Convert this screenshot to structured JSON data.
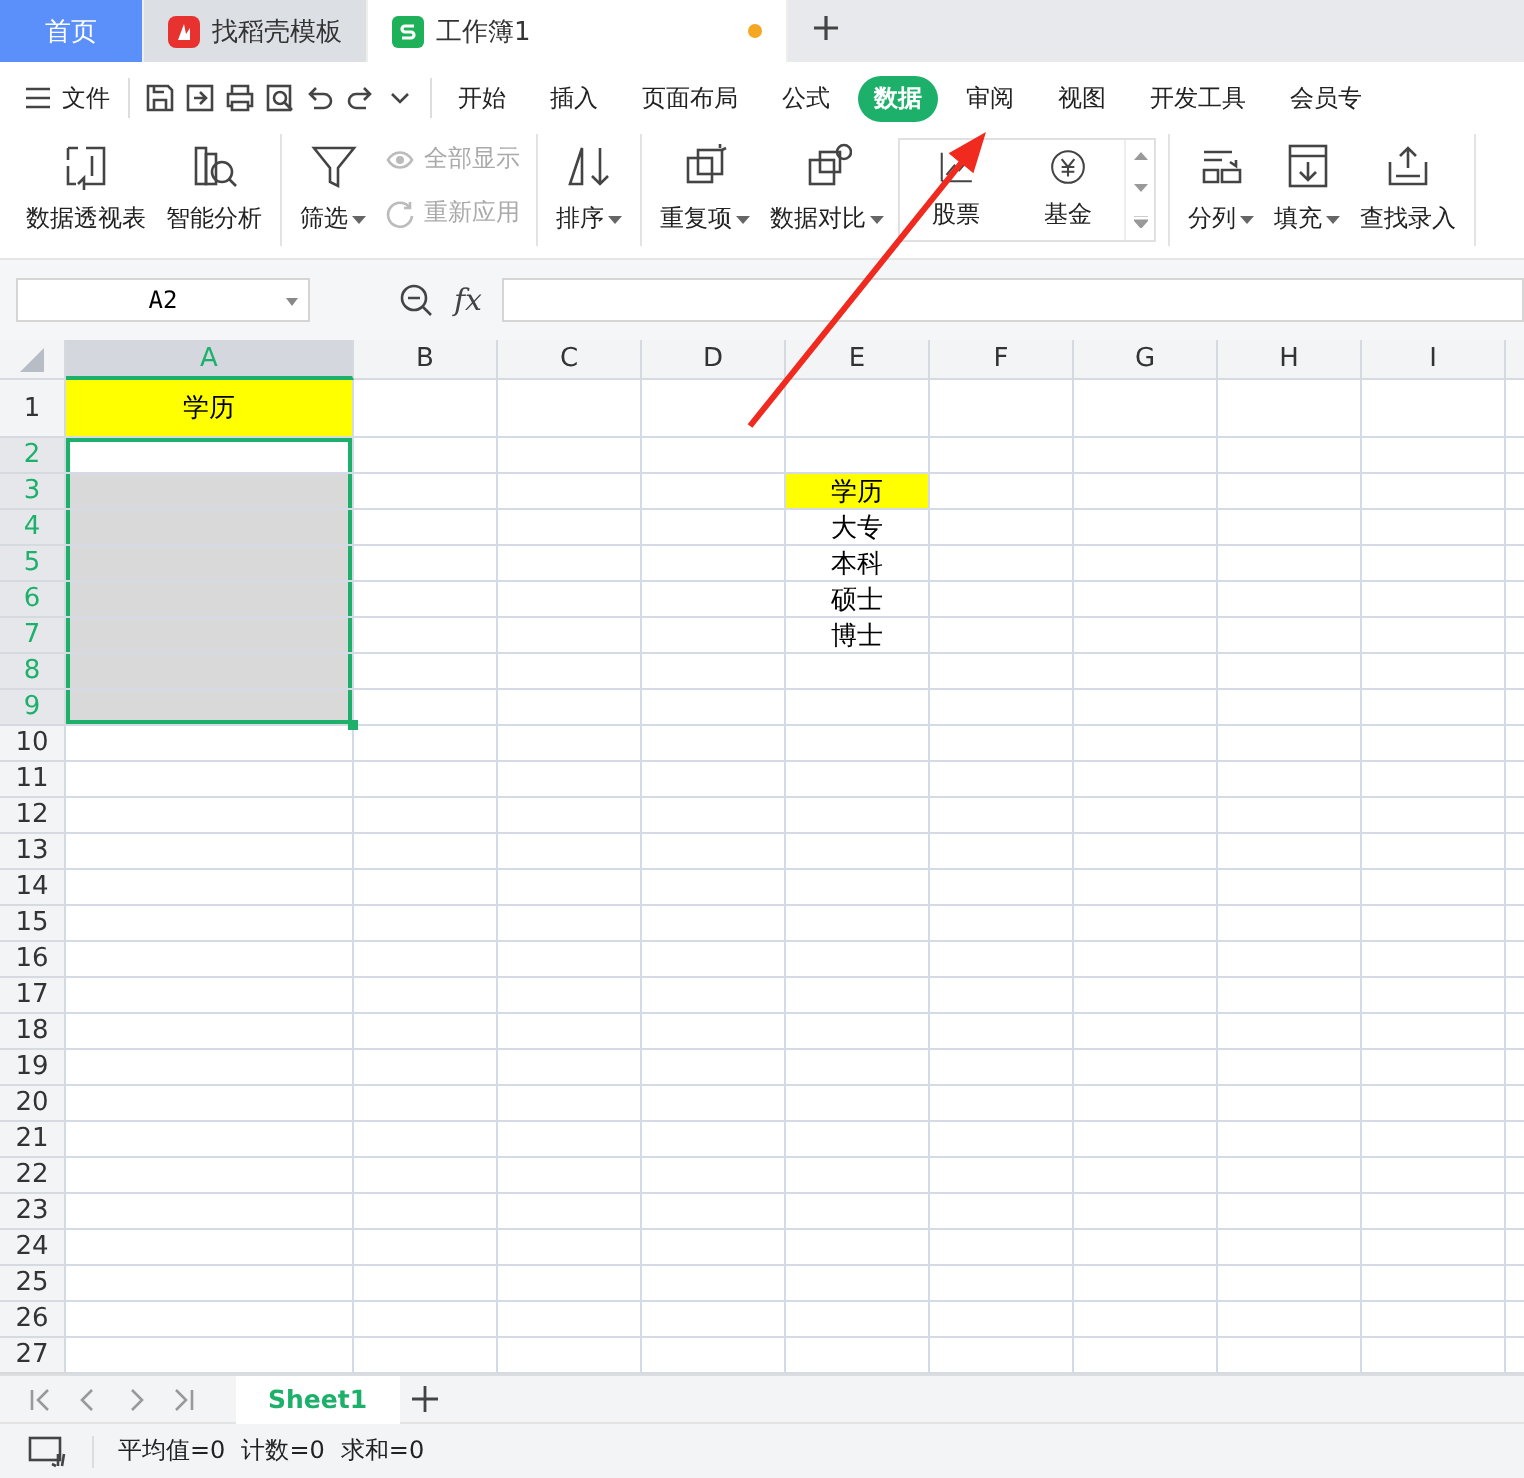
{
  "tabs": [
    {
      "label": "首页",
      "kind": "home",
      "selected": false
    },
    {
      "label": "找稻壳模板",
      "kind": "docer",
      "selected": false
    },
    {
      "label": "工作簿1",
      "kind": "sheet",
      "selected": true,
      "unsaved": true
    }
  ],
  "menu": {
    "file_label": "文件",
    "tabs": [
      {
        "label": "开始",
        "selected": false
      },
      {
        "label": "插入",
        "selected": false
      },
      {
        "label": "页面布局",
        "selected": false
      },
      {
        "label": "公式",
        "selected": false
      },
      {
        "label": "数据",
        "selected": true
      },
      {
        "label": "审阅",
        "selected": false
      },
      {
        "label": "视图",
        "selected": false
      },
      {
        "label": "开发工具",
        "selected": false
      },
      {
        "label": "会员专",
        "selected": false
      }
    ]
  },
  "ribbon": [
    [
      {
        "kind": "large",
        "label": "数据透视表",
        "caret": false
      },
      {
        "kind": "large",
        "label": "智能分析",
        "caret": false
      }
    ],
    [
      {
        "kind": "large",
        "label": "筛选",
        "caret": true
      },
      {
        "kind": "small",
        "label": "全部显示",
        "disabled": true
      },
      {
        "kind": "small",
        "label": "重新应用",
        "disabled": true
      }
    ],
    [
      {
        "kind": "large",
        "label": "排序",
        "caret": true
      }
    ],
    [
      {
        "kind": "large",
        "label": "重复项",
        "caret": true
      },
      {
        "kind": "large",
        "label": "数据对比",
        "caret": true
      },
      {
        "kind": "gallery",
        "items": [
          {
            "label": "股票"
          },
          {
            "label": "基金"
          }
        ]
      }
    ],
    [
      {
        "kind": "large",
        "label": "分列",
        "caret": true
      },
      {
        "kind": "large",
        "label": "填充",
        "caret": true
      },
      {
        "kind": "large",
        "label": "查找录入",
        "caret": false
      }
    ]
  ],
  "formula_bar": {
    "name_box": "A2",
    "fx_label": "fx"
  },
  "columns": [
    {
      "label": "A",
      "selected": true
    },
    {
      "label": "B",
      "selected": false
    },
    {
      "label": "C",
      "selected": false
    },
    {
      "label": "D",
      "selected": false
    },
    {
      "label": "E",
      "selected": false
    },
    {
      "label": "F",
      "selected": false
    },
    {
      "label": "G",
      "selected": false
    },
    {
      "label": "H",
      "selected": false
    },
    {
      "label": "I",
      "selected": false
    }
  ],
  "rows": [
    {
      "label": "1",
      "selected": false,
      "cells": {
        "A": {
          "text": "学历",
          "highlighted": true
        }
      }
    },
    {
      "label": "2",
      "selected": true,
      "cells": {
        "A": {
          "selected": true,
          "active": true
        }
      }
    },
    {
      "label": "3",
      "selected": true,
      "cells": {
        "A": {
          "selected": true,
          "active": false
        },
        "E": {
          "text": "学历",
          "highlighted": true
        }
      }
    },
    {
      "label": "4",
      "selected": true,
      "cells": {
        "A": {
          "selected": true,
          "active": false
        },
        "E": {
          "text": "大专",
          "highlighted": false
        }
      }
    },
    {
      "label": "5",
      "selected": true,
      "cells": {
        "A": {
          "selected": true,
          "active": false
        },
        "E": {
          "text": "本科",
          "highlighted": false
        }
      }
    },
    {
      "label": "6",
      "selected": true,
      "cells": {
        "A": {
          "selected": true,
          "active": false
        },
        "E": {
          "text": "硕士",
          "highlighted": false
        }
      }
    },
    {
      "label": "7",
      "selected": true,
      "cells": {
        "A": {
          "selected": true,
          "active": false
        },
        "E": {
          "text": "博士",
          "highlighted": false
        }
      }
    },
    {
      "label": "8",
      "selected": true,
      "cells": {
        "A": {
          "selected": true,
          "active": false
        }
      }
    },
    {
      "label": "9",
      "selected": true,
      "cells": {
        "A": {
          "selected": true,
          "active": false
        }
      }
    },
    {
      "label": "10",
      "selected": false,
      "cells": {}
    },
    {
      "label": "11",
      "selected": false,
      "cells": {}
    },
    {
      "label": "12",
      "selected": false,
      "cells": {}
    },
    {
      "label": "13",
      "selected": false,
      "cells": {}
    },
    {
      "label": "14",
      "selected": false,
      "cells": {}
    },
    {
      "label": "15",
      "selected": false,
      "cells": {}
    },
    {
      "label": "16",
      "selected": false,
      "cells": {}
    },
    {
      "label": "17",
      "selected": false,
      "cells": {}
    },
    {
      "label": "18",
      "selected": false,
      "cells": {}
    },
    {
      "label": "19",
      "selected": false,
      "cells": {}
    },
    {
      "label": "20",
      "selected": false,
      "cells": {}
    },
    {
      "label": "21",
      "selected": false,
      "cells": {}
    },
    {
      "label": "22",
      "selected": false,
      "cells": {}
    },
    {
      "label": "23",
      "selected": false,
      "cells": {}
    },
    {
      "label": "24",
      "selected": false,
      "cells": {}
    },
    {
      "label": "25",
      "selected": false,
      "cells": {}
    },
    {
      "label": "26",
      "selected": false,
      "cells": {}
    },
    {
      "label": "27",
      "selected": false,
      "cells": {}
    }
  ],
  "sheets": [
    {
      "label": "Sheet1",
      "selected": true
    }
  ],
  "status_bar": [
    "平均值=0",
    "计数=0",
    "求和=0"
  ]
}
